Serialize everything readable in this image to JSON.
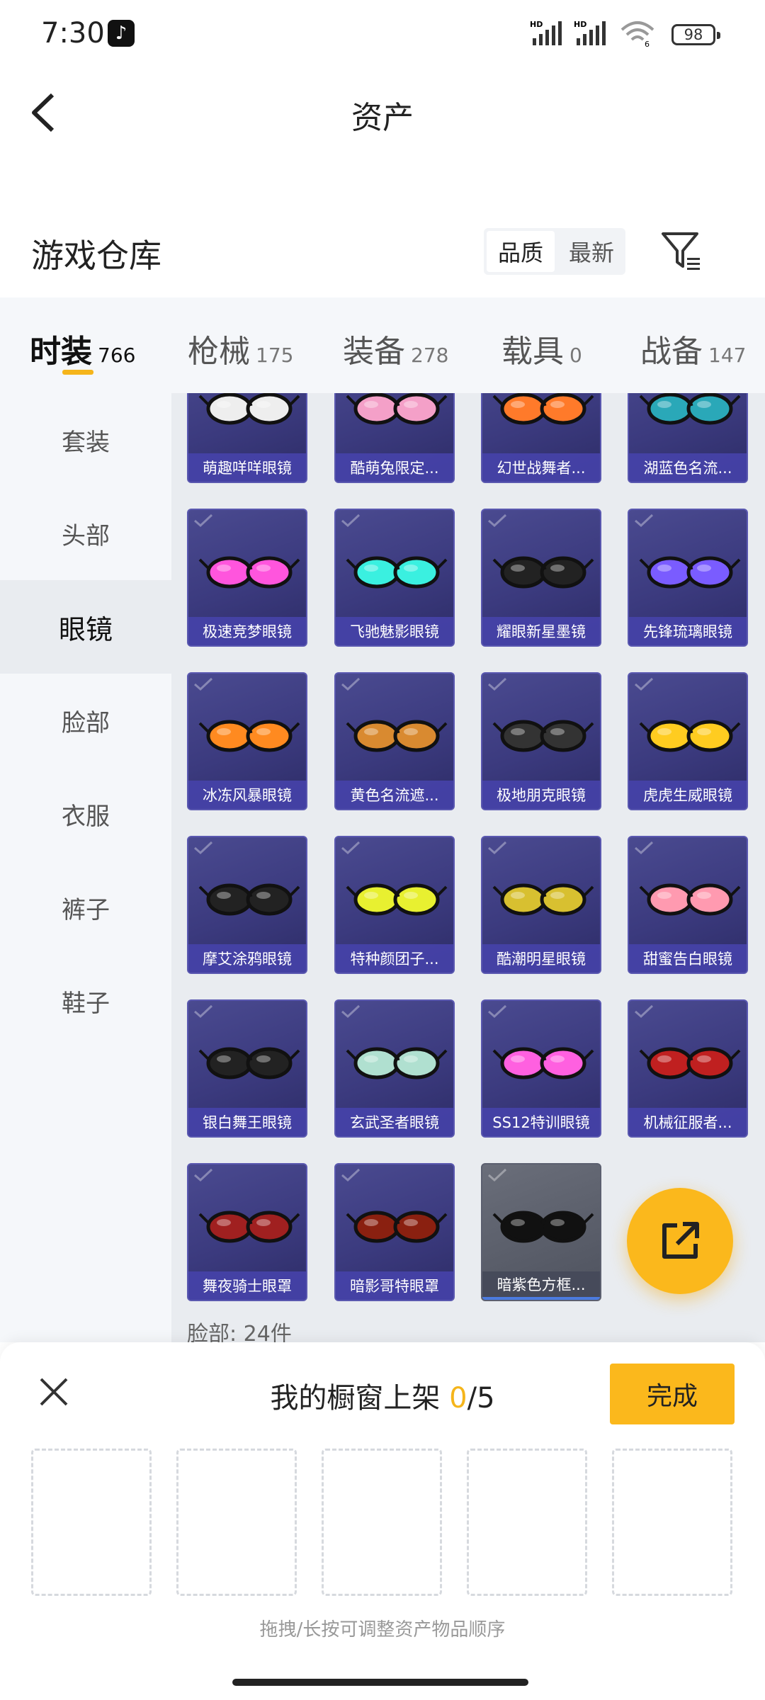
{
  "status": {
    "time": "7:30",
    "battery": "98",
    "net1": "HD",
    "net2": "HD",
    "wifi_band": "6"
  },
  "nav": {
    "title": "资产"
  },
  "warehouse": {
    "title": "游戏仓库",
    "sort_quality": "品质",
    "sort_newest": "最新"
  },
  "tabs": [
    {
      "label": "时装",
      "count": "766"
    },
    {
      "label": "枪械",
      "count": "175"
    },
    {
      "label": "装备",
      "count": "278"
    },
    {
      "label": "载具",
      "count": "0"
    },
    {
      "label": "战备",
      "count": "147"
    }
  ],
  "sidebar": [
    {
      "label": "套装"
    },
    {
      "label": "头部"
    },
    {
      "label": "眼镜"
    },
    {
      "label": "脸部"
    },
    {
      "label": "衣服"
    },
    {
      "label": "裤子"
    },
    {
      "label": "鞋子"
    }
  ],
  "items": [
    {
      "name": "萌趣咩咩眼镜"
    },
    {
      "name": "酷萌兔限定..."
    },
    {
      "name": "幻世战舞者..."
    },
    {
      "name": "湖蓝色名流..."
    },
    {
      "name": "极速竞梦眼镜"
    },
    {
      "name": "飞驰魅影眼镜"
    },
    {
      "name": "耀眼新星墨镜"
    },
    {
      "name": "先锋琉璃眼镜"
    },
    {
      "name": "冰冻风暴眼镜"
    },
    {
      "name": "黄色名流遮..."
    },
    {
      "name": "极地朋克眼镜"
    },
    {
      "name": "虎虎生威眼镜"
    },
    {
      "name": "摩艾涂鸦眼镜"
    },
    {
      "name": "特种颜团子..."
    },
    {
      "name": "酷潮明星眼镜"
    },
    {
      "name": "甜蜜告白眼镜"
    },
    {
      "name": "银白舞王眼镜"
    },
    {
      "name": "玄武圣者眼镜"
    },
    {
      "name": "SS12特训眼镜"
    },
    {
      "name": "机械征服者..."
    },
    {
      "name": "舞夜骑士眼罩"
    },
    {
      "name": "暗影哥特眼罩"
    },
    {
      "name": "暗紫色方框..."
    }
  ],
  "next_group": "脸部: 24件",
  "showcase": {
    "title_prefix": "我的橱窗上架 ",
    "count_current": "0",
    "count_total": "/5",
    "done": "完成",
    "hint": "拖拽/长按可调整资产物品顺序"
  }
}
